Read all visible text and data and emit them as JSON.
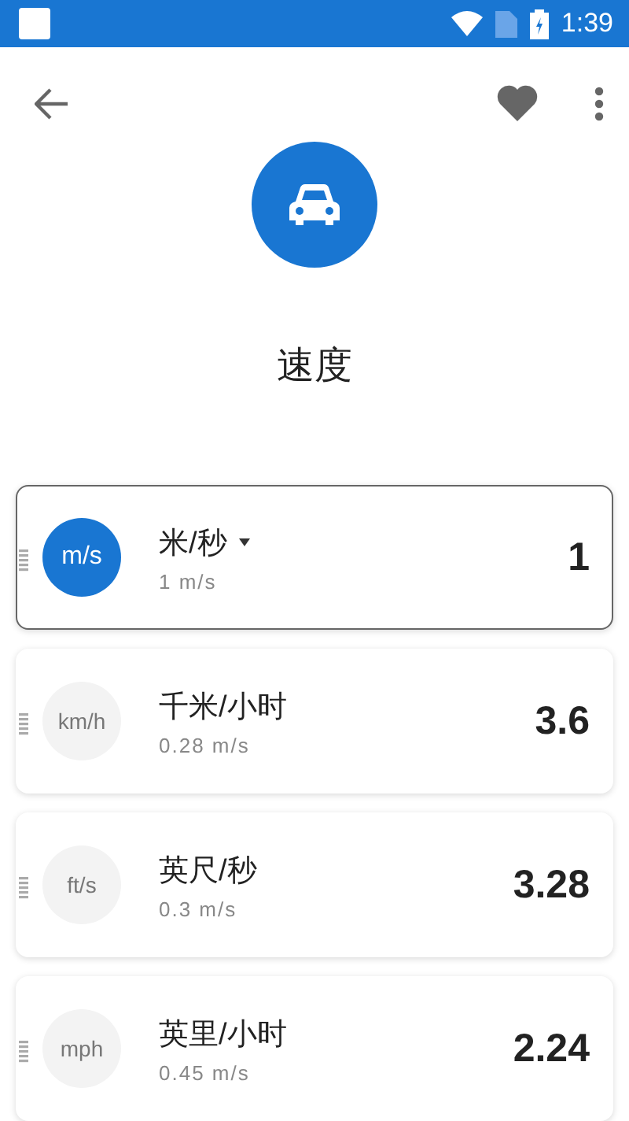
{
  "status_bar": {
    "time": "1:39"
  },
  "title": "速度",
  "units": [
    {
      "symbol": "m/s",
      "name": "米/秒",
      "detail": "1 m/s",
      "value": "1",
      "selected": true
    },
    {
      "symbol": "km/h",
      "name": "千米/小时",
      "detail": "0.28 m/s",
      "value": "3.6",
      "selected": false
    },
    {
      "symbol": "ft/s",
      "name": "英尺/秒",
      "detail": "0.3 m/s",
      "value": "3.28",
      "selected": false
    },
    {
      "symbol": "mph",
      "name": "英里/小时",
      "detail": "0.45 m/s",
      "value": "2.24",
      "selected": false
    }
  ]
}
